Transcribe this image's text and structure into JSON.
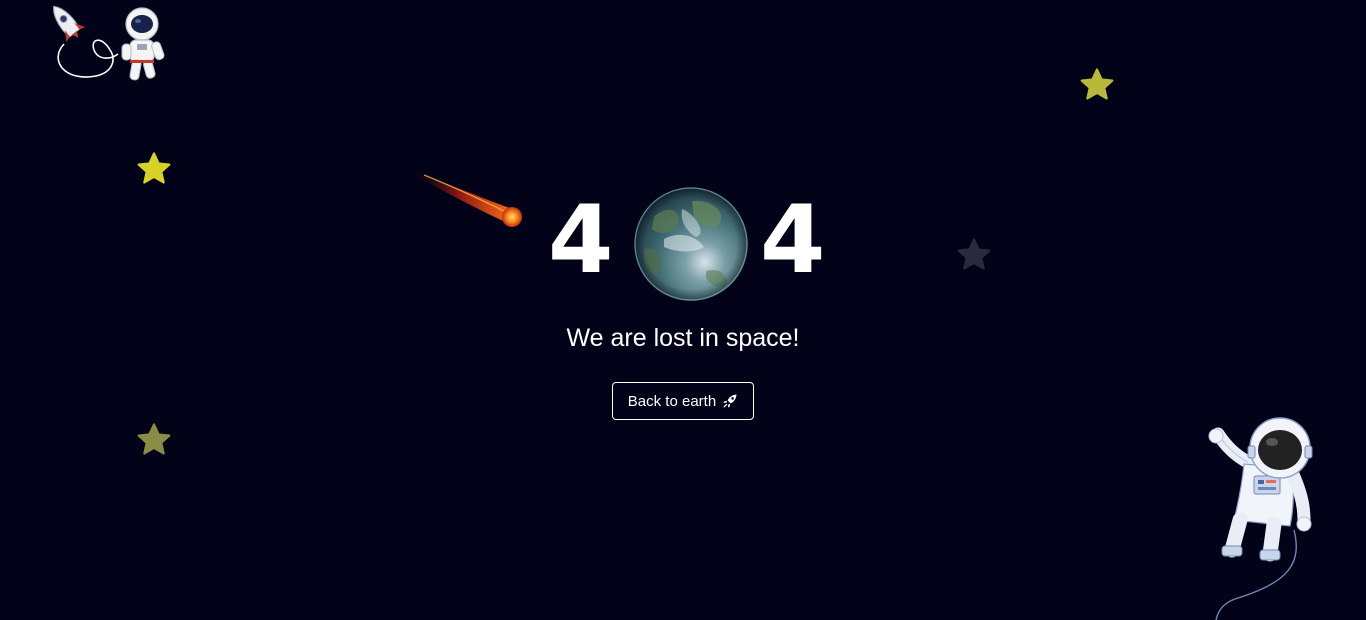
{
  "error": {
    "digit_left": "4",
    "digit_right": "4",
    "message": "We are lost in space!"
  },
  "actions": {
    "back_label": "Back to earth"
  },
  "icons": {
    "planet": "earth-icon",
    "button_icon": "rocket-icon",
    "meteor": "meteor-icon",
    "astronaut_top": "astronaut-with-rocket",
    "astronaut_bottom": "waving-astronaut",
    "stars": "star-icon"
  },
  "colors": {
    "background": "#020218",
    "text": "#ffffff",
    "star_bright": "#d7d226",
    "star_olive": "#b9b83a",
    "star_dim": "#8a8b45",
    "star_dark": "#2a2b3a"
  }
}
